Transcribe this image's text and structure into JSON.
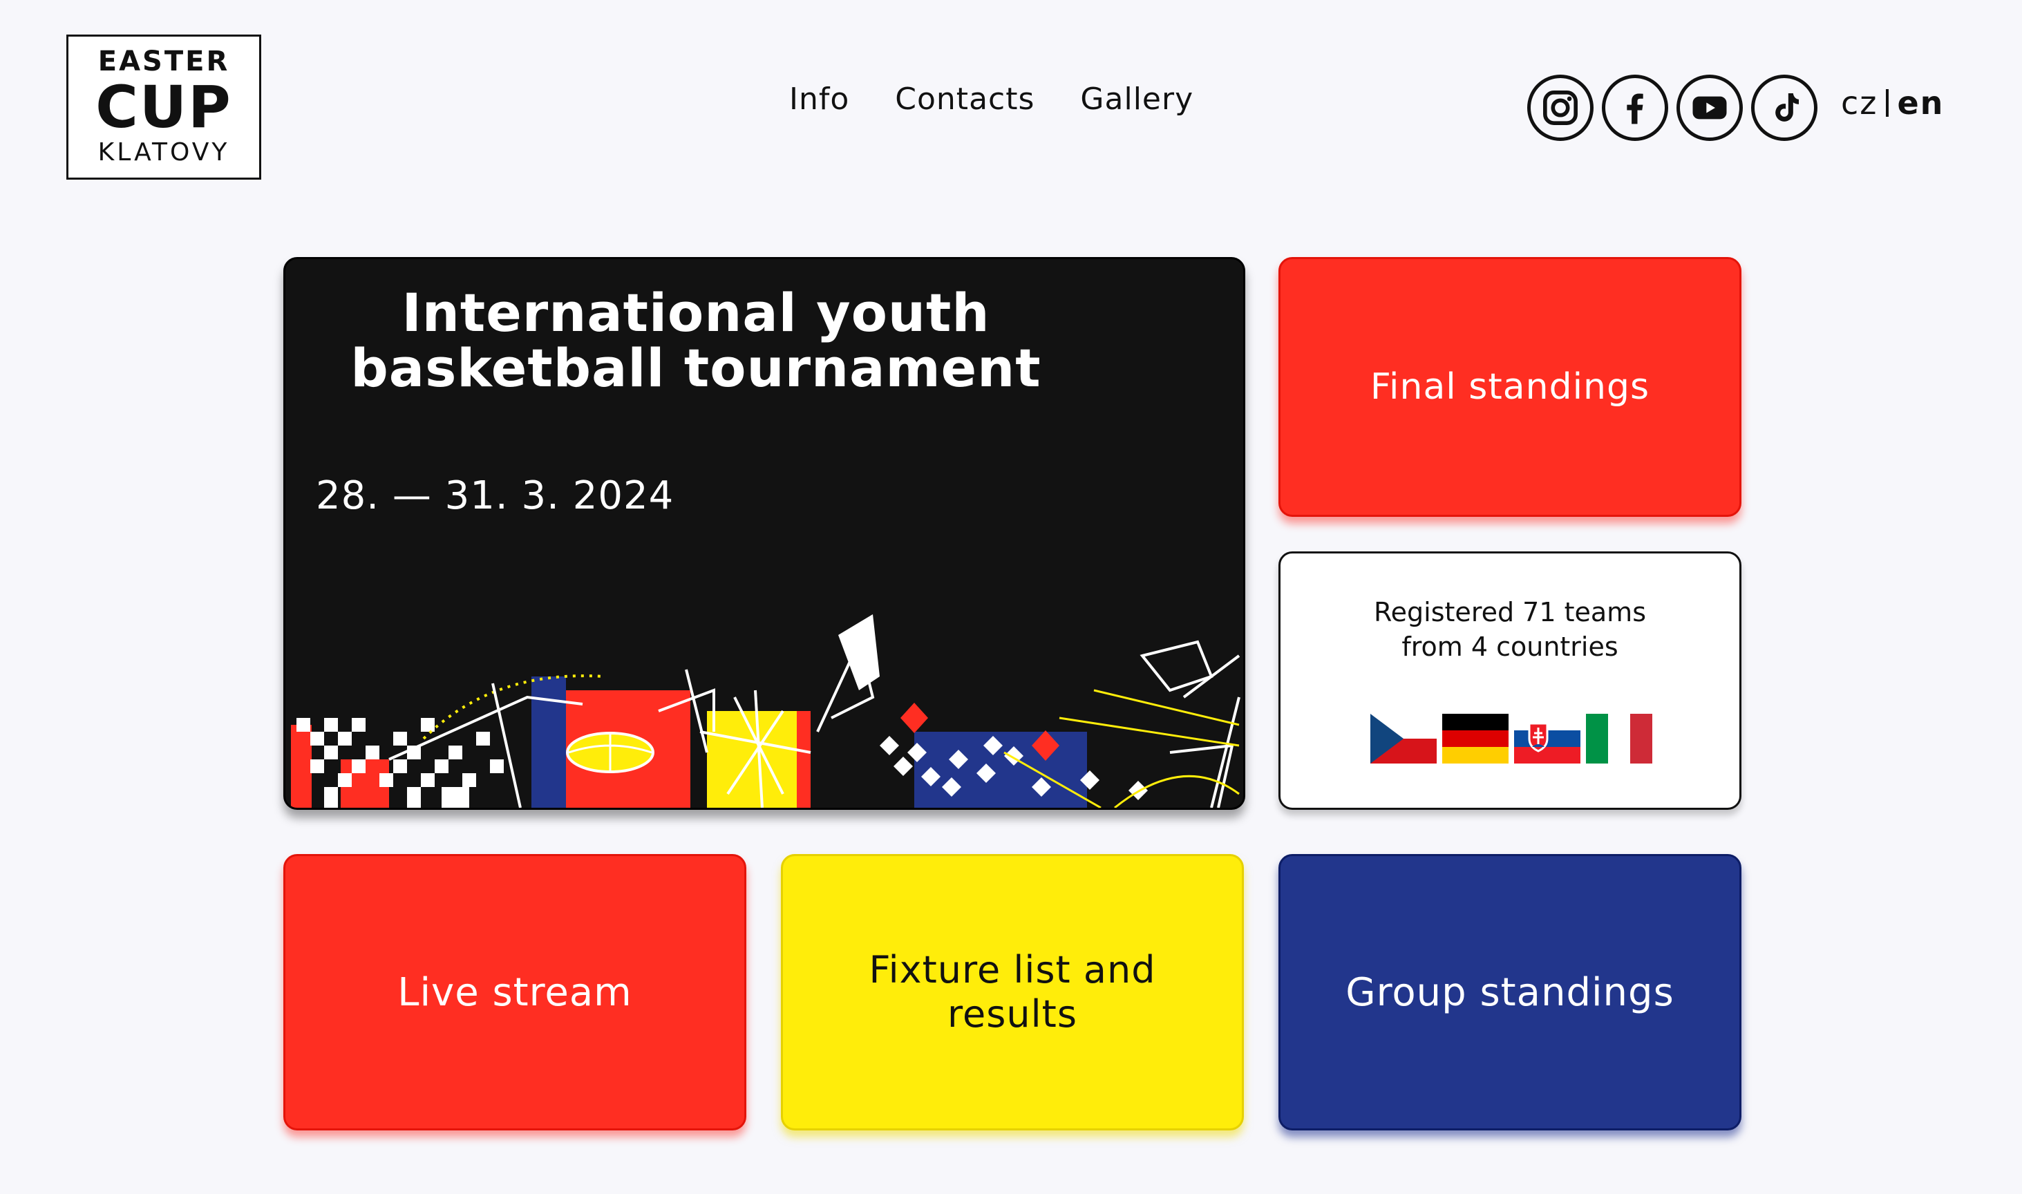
{
  "header": {
    "logo": {
      "line1": "EASTER",
      "line2": "CUP",
      "line3": "KLATOVY"
    },
    "nav": [
      "Info",
      "Contacts",
      "Gallery"
    ],
    "socials": [
      "instagram-icon",
      "facebook-icon",
      "youtube-icon",
      "tiktok-icon"
    ],
    "lang": {
      "cz": "cz",
      "en": "en",
      "active": "en"
    }
  },
  "hero": {
    "title": "International youth basketball tournament",
    "date": "28. — 31. 3. 2024"
  },
  "cards": {
    "final_standings": "Final standings",
    "registered_line1": "Registered 71 teams",
    "registered_line2": "from 4 countries",
    "live_stream": "Live stream",
    "fixture": "Fixture list and results",
    "group_standings": "Group standings"
  },
  "flags": [
    "czech-flag",
    "german-flag",
    "slovak-flag",
    "italian-flag"
  ],
  "colors": {
    "red": "#ff2e22",
    "yellow": "#ffed0a",
    "blue": "#22368c",
    "dark": "#121212",
    "background": "#f7f7fb"
  }
}
